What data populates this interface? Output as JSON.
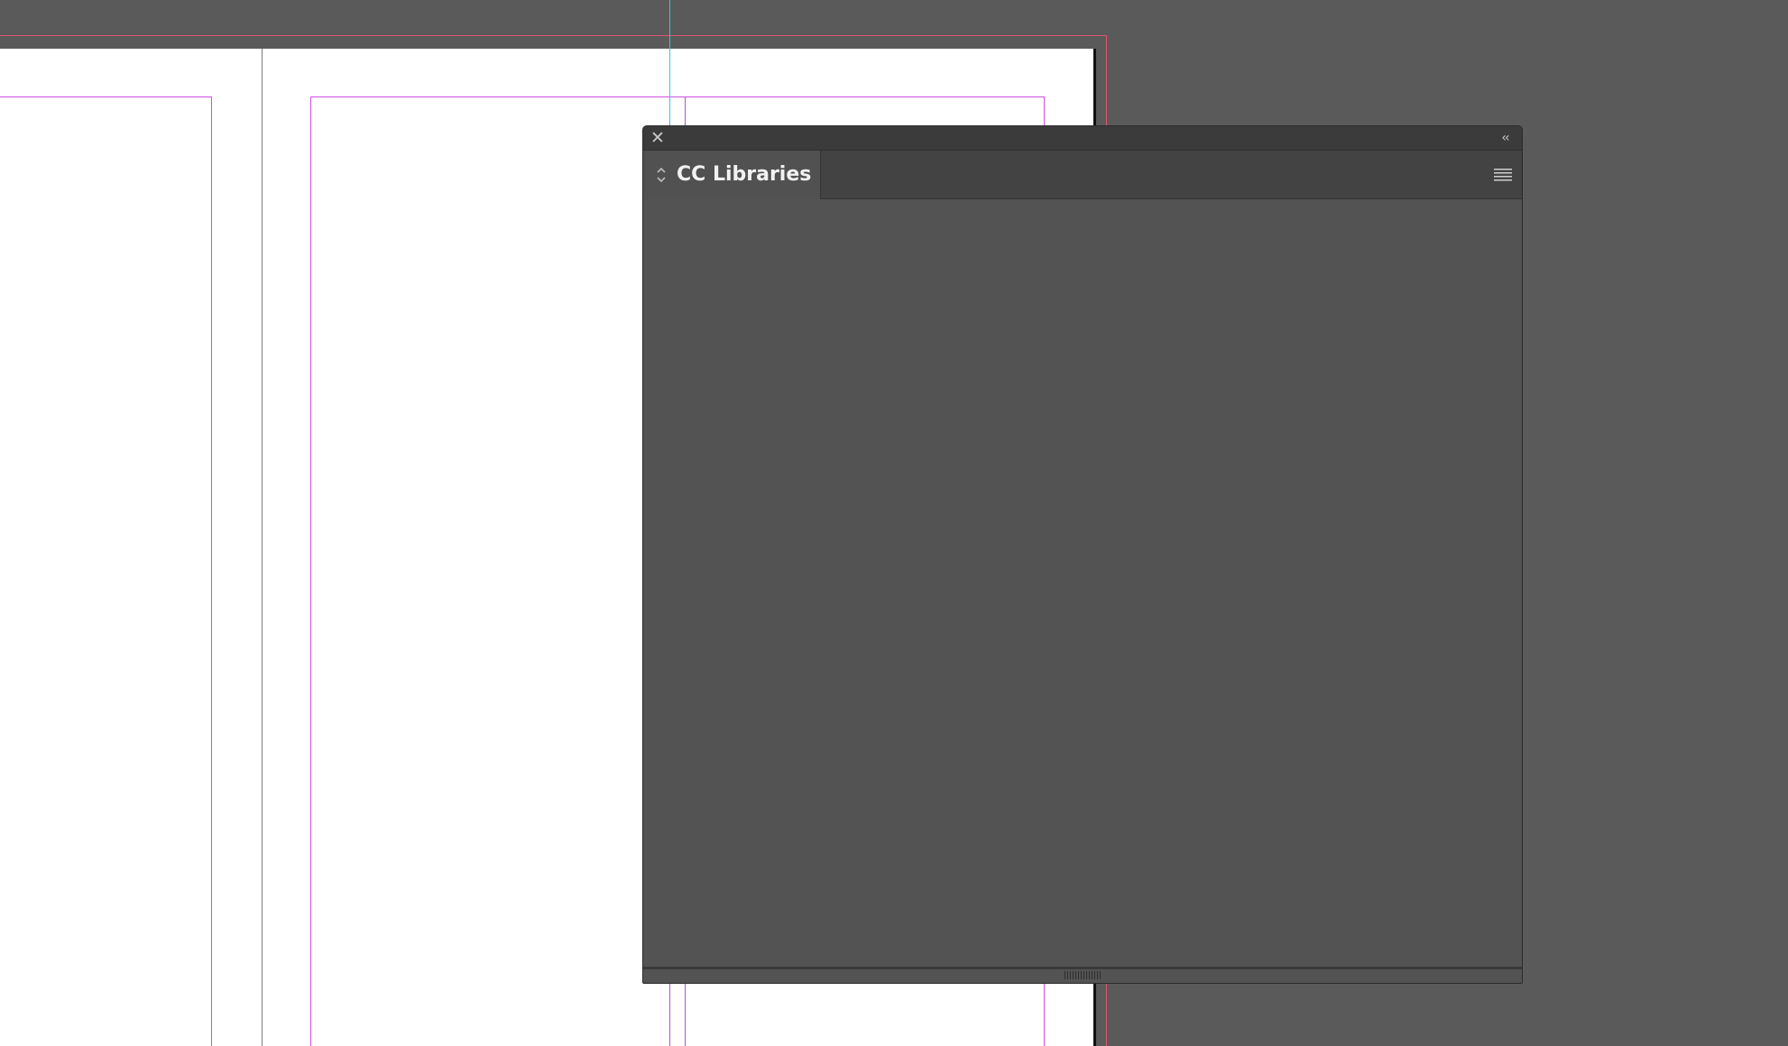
{
  "panel": {
    "tab_label": "CC Libraries",
    "icons": {
      "close": "close-icon",
      "collapse": "double-chevron-left-icon",
      "tab_arrows": "up-down-arrows-icon",
      "menu": "hamburger-menu-icon",
      "resize": "resize-grip-icon"
    }
  },
  "colors": {
    "pasteboard": "#5a5a5a",
    "page": "#ffffff",
    "bleed_guide": "#e0566d",
    "margin_guide": "#cf4fe0",
    "ruler_guide": "#35c8d8",
    "panel_body": "#535353"
  }
}
